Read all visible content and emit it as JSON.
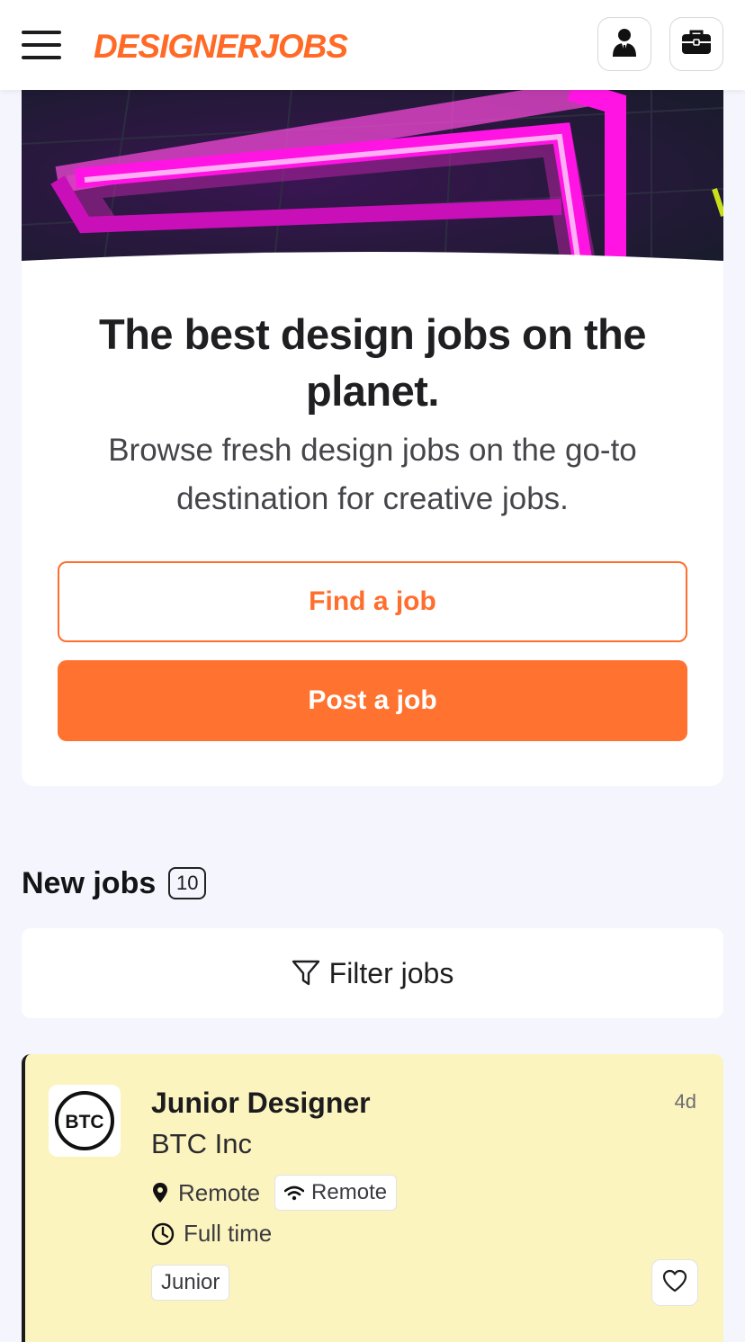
{
  "header": {
    "logo_text": "DESIGNERJOBS",
    "accent_color": "#ff6a26",
    "menu_icon": "hamburger-menu-icon",
    "account_icon": "user-icon",
    "jobs_icon": "briefcase-icon"
  },
  "hero": {
    "title": "The best design jobs on the planet.",
    "subtitle": "Browse fresh design jobs on the go-to destination for creative jobs.",
    "find_label": "Find a job",
    "post_label": "Post a job"
  },
  "new_jobs": {
    "title": "New jobs",
    "count": "10",
    "filter_label": "Filter jobs",
    "filter_icon": "filter-icon"
  },
  "job": {
    "logo_text": "BTC",
    "title": "Junior Designer",
    "company": "BTC Inc",
    "age": "4d",
    "location": "Remote",
    "remote_chip": "Remote",
    "employment": "Full time",
    "level": "Junior",
    "card_color": "#fcf4bf",
    "favorite_icon": "heart-icon"
  }
}
